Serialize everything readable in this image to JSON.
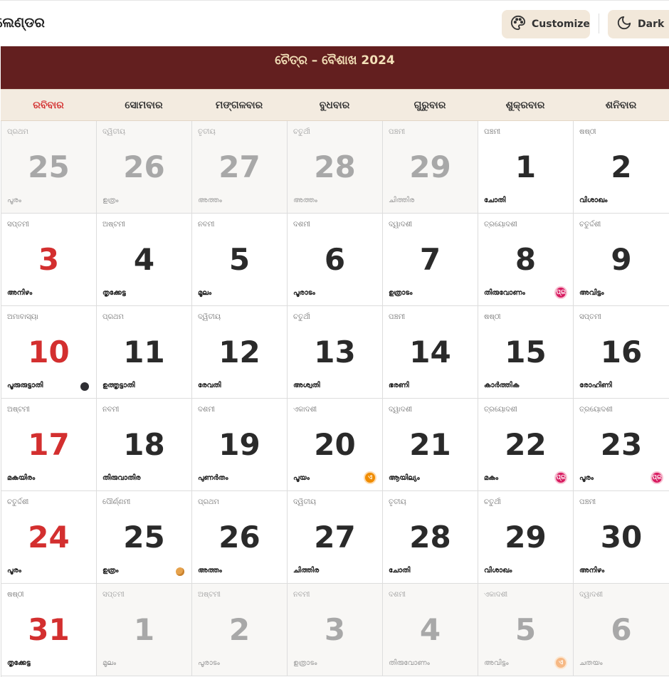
{
  "app": {
    "title": "ଲେଣ୍ଡର"
  },
  "toolbar": {
    "customize_label": "Customize",
    "customize_icon": "palette-icon",
    "dark_label": "Dark",
    "dark_icon": "moon-icon"
  },
  "calendar": {
    "title": "ଚୈତ୍ର – ବୈଶାଖ 2024",
    "weekdays": [
      "ରବିବାର",
      "ସୋମବାର",
      "ମଙ୍ଗଳବାର",
      "ବୁଧବାର",
      "ଗୁରୁବାର",
      "ଶୁକ୍ରବାର",
      "ଶନିବାର"
    ],
    "weeks": [
      [
        {
          "day": "25",
          "tithi": "ପ୍ରଥମ",
          "star": "പൂരം",
          "other": true
        },
        {
          "day": "26",
          "tithi": "ଦ୍ୱିତୀୟ",
          "star": "ഉത്രം",
          "other": true
        },
        {
          "day": "27",
          "tithi": "ତୃତୀୟ",
          "star": "അത്തം",
          "other": true
        },
        {
          "day": "28",
          "tithi": "ଚତୁର୍ଥୀ",
          "star": "അത്തം",
          "other": true
        },
        {
          "day": "29",
          "tithi": "ପଞ୍ଚମୀ",
          "star": "ചിത്തിര",
          "other": true
        },
        {
          "day": "1",
          "tithi": "ପଞ୍ଚମୀ",
          "star": "ചോതി"
        },
        {
          "day": "2",
          "tithi": "ଷଷ୍ଠୀ",
          "star": "വിശാഖം"
        }
      ],
      [
        {
          "day": "3",
          "tithi": "ସପ୍ତମୀ",
          "star": "അനിഴം"
        },
        {
          "day": "4",
          "tithi": "ଅଷ୍ଟମୀ",
          "star": "തൃക്കേട്ട"
        },
        {
          "day": "5",
          "tithi": "ନବମୀ",
          "star": "മൂലം"
        },
        {
          "day": "6",
          "tithi": "ଦଶମୀ",
          "star": "പൂരാടം"
        },
        {
          "day": "7",
          "tithi": "ଦ୍ୱାଦଶୀ",
          "star": "ഉത്രാടം"
        },
        {
          "day": "8",
          "tithi": "ତ୍ରୟୋଦଶୀ",
          "star": "തിരുവോണം",
          "badge": "ପ୍ର",
          "badge_color": "pink"
        },
        {
          "day": "9",
          "tithi": "ଚତୁର୍ଦ୍ଦଶୀ",
          "star": "അവിട്ടം"
        }
      ],
      [
        {
          "day": "10",
          "tithi": "ଅମାବାସ୍ୟା",
          "star": "പൂരുരുട്ടാതി",
          "moon": "new"
        },
        {
          "day": "11",
          "tithi": "ପ୍ରଥମ",
          "star": "ഉത്തൃട്ടാതി"
        },
        {
          "day": "12",
          "tithi": "ଦ୍ୱିତୀୟ",
          "star": "രേവതി"
        },
        {
          "day": "13",
          "tithi": "ଚତୁର୍ଥୀ",
          "star": "അശ്വതി"
        },
        {
          "day": "14",
          "tithi": "ପଞ୍ଚମୀ",
          "star": "ഭരണി"
        },
        {
          "day": "15",
          "tithi": "ଷଷ୍ଠୀ",
          "star": "കാർത്തിക"
        },
        {
          "day": "16",
          "tithi": "ସପ୍ତମୀ",
          "star": "രോഹിണി"
        }
      ],
      [
        {
          "day": "17",
          "tithi": "ଅଷ୍ଟମୀ",
          "star": "മകയിരം"
        },
        {
          "day": "18",
          "tithi": "ନବମୀ",
          "star": "തിരുവാതിര"
        },
        {
          "day": "19",
          "tithi": "ଦଶମୀ",
          "star": "പുണർതം"
        },
        {
          "day": "20",
          "tithi": "ଏକାଦଶୀ",
          "star": "പൂയം",
          "badge": "ଏ",
          "badge_color": "orange"
        },
        {
          "day": "21",
          "tithi": "ଦ୍ୱାଦଶୀ",
          "star": "ആയില്യം"
        },
        {
          "day": "22",
          "tithi": "ତ୍ରୟୋଦଶୀ",
          "star": "മകം",
          "badge": "ପ୍ର",
          "badge_color": "pink"
        },
        {
          "day": "23",
          "tithi": "ତ୍ରୟୋଦଶୀ",
          "star": "പൂരം",
          "badge": "ପ୍ର",
          "badge_color": "pink"
        }
      ],
      [
        {
          "day": "24",
          "tithi": "ଚତୁର୍ଦ୍ଦଶୀ",
          "star": "പൂരം"
        },
        {
          "day": "25",
          "tithi": "ପୌର୍ଣ୍ଣମୀ",
          "star": "ഉത്രം",
          "moon": "full"
        },
        {
          "day": "26",
          "tithi": "ପ୍ରଥମ",
          "star": "അത്തം"
        },
        {
          "day": "27",
          "tithi": "ଦ୍ୱିତୀୟ",
          "star": "ചിത്തിര"
        },
        {
          "day": "28",
          "tithi": "ତୃତୀୟ",
          "star": "ചോതി"
        },
        {
          "day": "29",
          "tithi": "ଚତୁର୍ଥୀ",
          "star": "വിശാഖം"
        },
        {
          "day": "30",
          "tithi": "ପଞ୍ଚମୀ",
          "star": "അനിഴം"
        }
      ],
      [
        {
          "day": "31",
          "tithi": "ଷଷ୍ଠୀ",
          "star": "തൃക്കേട്ട"
        },
        {
          "day": "1",
          "tithi": "ସପ୍ତମୀ",
          "star": "മൂലം",
          "other": true
        },
        {
          "day": "2",
          "tithi": "ଅଷ୍ଟମୀ",
          "star": "പൂരാടം",
          "other": true
        },
        {
          "day": "3",
          "tithi": "ନବମୀ",
          "star": "ഉത്രാടം",
          "other": true
        },
        {
          "day": "4",
          "tithi": "ଦଶମୀ",
          "star": "തിരുവോണം",
          "other": true
        },
        {
          "day": "5",
          "tithi": "ଏକାଦଶୀ",
          "star": "അവിട്ടം",
          "other": true,
          "badge": "ଏ",
          "badge_color": "pale"
        },
        {
          "day": "6",
          "tithi": "ଦ୍ୱାଦଶୀ",
          "star": "ചതയം",
          "other": true
        }
      ]
    ]
  },
  "colors": {
    "header_bg": "#631f1f",
    "header_text": "#f3e0b8",
    "sunday": "#d32f2f",
    "weekday_bar": "#f3ebe0",
    "button_bg": "#f2e8da"
  }
}
